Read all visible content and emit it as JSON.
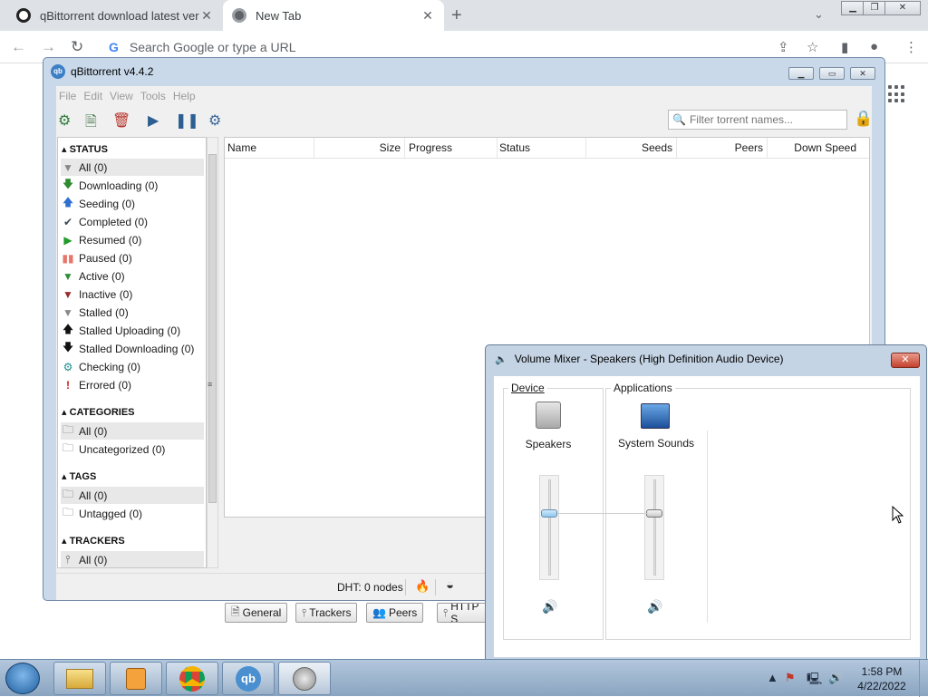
{
  "browser": {
    "tabs": [
      {
        "title": "qBittorrent download latest versi"
      },
      {
        "title": "New Tab"
      }
    ],
    "omnibox_placeholder": "Search Google or type a URL"
  },
  "qbittorrent": {
    "title": "qBittorrent v4.4.2",
    "menu": [
      "File",
      "Edit",
      "View",
      "Tools",
      "Help"
    ],
    "filter_placeholder": "Filter torrent names...",
    "sections": {
      "status": "STATUS",
      "categories": "CATEGORIES",
      "tags": "TAGS",
      "trackers": "TRACKERS"
    },
    "status_items": [
      {
        "label": "All (0)",
        "icon": "filter-icon"
      },
      {
        "label": "Downloading (0)",
        "icon": "arrow-down-icon"
      },
      {
        "label": "Seeding (0)",
        "icon": "arrow-up-icon"
      },
      {
        "label": "Completed (0)",
        "icon": "checkmark-icon"
      },
      {
        "label": "Resumed (0)",
        "icon": "play-icon"
      },
      {
        "label": "Paused (0)",
        "icon": "pause-icon"
      },
      {
        "label": "Active (0)",
        "icon": "filter-icon"
      },
      {
        "label": "Inactive (0)",
        "icon": "filter-icon"
      },
      {
        "label": "Stalled (0)",
        "icon": "filter-icon"
      },
      {
        "label": "Stalled Uploading (0)",
        "icon": "arrow-up-icon"
      },
      {
        "label": "Stalled Downloading (0)",
        "icon": "arrow-down-icon"
      },
      {
        "label": "Checking (0)",
        "icon": "gear-icon"
      },
      {
        "label": "Errored (0)",
        "icon": "exclamation-icon"
      }
    ],
    "category_items": [
      "All (0)",
      "Uncategorized (0)"
    ],
    "tag_items": [
      "All (0)",
      "Untagged (0)"
    ],
    "tracker_items": [
      "All (0)"
    ],
    "columns": [
      "Name",
      "Size",
      "Progress",
      "Status",
      "Seeds",
      "Peers",
      "Down Speed"
    ],
    "bottom_tabs": [
      "General",
      "Trackers",
      "Peers",
      "HTTP S"
    ],
    "dht": "DHT: 0 nodes"
  },
  "volume_mixer": {
    "title": "Volume Mixer - Speakers (High Definition Audio Device)",
    "device_label": "Device",
    "applications_label": "Applications",
    "device_name": "Speakers",
    "app_name": "System Sounds",
    "speakers_level": 0.65,
    "system_sounds_level": 0.65
  },
  "taskbar": {
    "time": "1:58 PM",
    "date": "4/22/2022"
  }
}
